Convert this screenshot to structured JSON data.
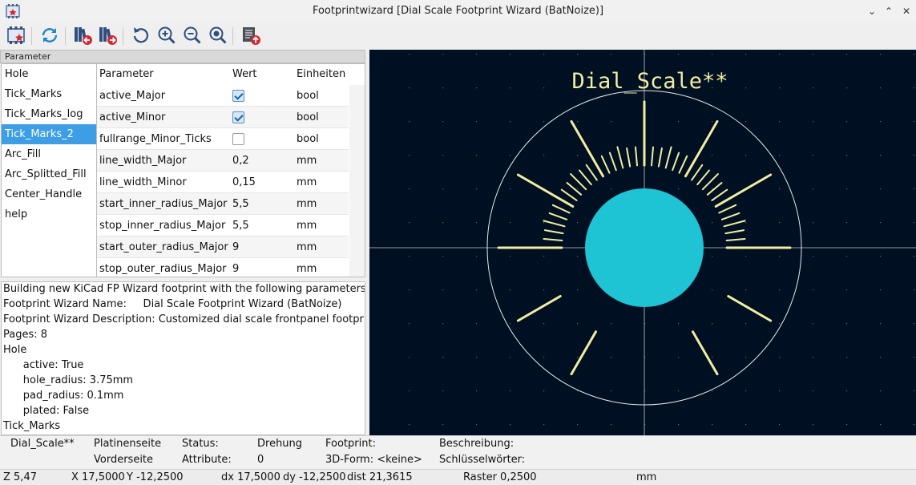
{
  "window": {
    "title": "Footprintwizard [Dial Scale Footprint Wizard (BatNoize)]",
    "controls": [
      "minimize",
      "maximize",
      "close"
    ]
  },
  "toolbar": {
    "buttons": [
      {
        "id": "select-wizard",
        "icon": "footprint-wizard-icon"
      },
      {
        "id": "reset",
        "icon": "refresh-icon"
      },
      {
        "id": "prev-page",
        "icon": "library-prev-icon"
      },
      {
        "id": "next-page",
        "icon": "library-next-icon"
      },
      {
        "id": "redraw",
        "icon": "redraw-icon"
      },
      {
        "id": "zoom-in",
        "icon": "zoom-in-icon"
      },
      {
        "id": "zoom-out",
        "icon": "zoom-out-icon"
      },
      {
        "id": "zoom-fit",
        "icon": "zoom-fit-icon"
      },
      {
        "id": "export",
        "icon": "export-footprint-icon"
      }
    ]
  },
  "parameter_panel": {
    "header": "Parameter",
    "pages": [
      "Hole",
      "Tick_Marks",
      "Tick_Marks_log",
      "Tick_Marks_2",
      "Arc_Fill",
      "Arc_Splitted_Fill",
      "Center_Handle",
      "help"
    ],
    "selected_page": "Tick_Marks_2",
    "columns": {
      "name": "Parameter",
      "value": "Wert",
      "units": "Einheiten"
    },
    "rows": [
      {
        "name": "active_Major",
        "value": "",
        "checkbox": true,
        "checked": true,
        "units": "bool"
      },
      {
        "name": "active_Minor",
        "value": "",
        "checkbox": true,
        "checked": true,
        "units": "bool"
      },
      {
        "name": "fullrange_Minor_Ticks",
        "value": "",
        "checkbox": true,
        "checked": false,
        "units": "bool"
      },
      {
        "name": "line_width_Major",
        "value": "0,2",
        "checkbox": false,
        "units": "mm"
      },
      {
        "name": "line_width_Minor",
        "value": "0,15",
        "checkbox": false,
        "units": "mm"
      },
      {
        "name": "start_inner_radius_Major",
        "value": "5,5",
        "checkbox": false,
        "units": "mm"
      },
      {
        "name": "stop_inner_radius_Major",
        "value": "5,5",
        "checkbox": false,
        "units": "mm"
      },
      {
        "name": "start_outer_radius_Major",
        "value": "9",
        "checkbox": false,
        "units": "mm"
      },
      {
        "name": "stop_outer_radius_Major",
        "value": "9",
        "checkbox": false,
        "units": "mm"
      }
    ]
  },
  "message_log": {
    "lines": [
      "Building new KiCad FP Wizard footprint with the following parameters:",
      "Footprint Wizard Name:     Dial Scale Footprint Wizard (BatNoize)",
      "Footprint Wizard Description: Customized dial scale frontpanel footprints.",
      "Pages: 8",
      "Hole",
      "      active: True",
      "      hole_radius: 3.75mm",
      "      pad_radius: 0.1mm",
      "      plated: False",
      "Tick_Marks"
    ]
  },
  "canvas": {
    "reference_label": "Dial_Scale**",
    "colors": {
      "background": "#001023",
      "silkscreen": "#f2eda1",
      "pad": "#1ec4d4",
      "outline": "#e8e8e8"
    }
  },
  "status_bar": {
    "reference": "Dial_Scale**",
    "board_side_label": "Platinenseite",
    "board_side_value": "Vorderseite",
    "status_label": "Status:",
    "attributes_label": "Attribute:",
    "rotation_label": "Drehung",
    "rotation_value": "0",
    "footprint_label": "Footprint:",
    "model_3d": "3D-Form: <keine>",
    "description_label": "Beschreibung:",
    "keywords_label": "Schlüsselwörter:"
  },
  "coords_bar": {
    "zoom": "Z 5,47",
    "x": "X 17,5000",
    "y": "Y -12,2500",
    "dx": "dx 17,5000",
    "dy": "dy -12,2500",
    "dist": "dist 21,3615",
    "grid": "Raster 0,2500",
    "units": "mm"
  }
}
